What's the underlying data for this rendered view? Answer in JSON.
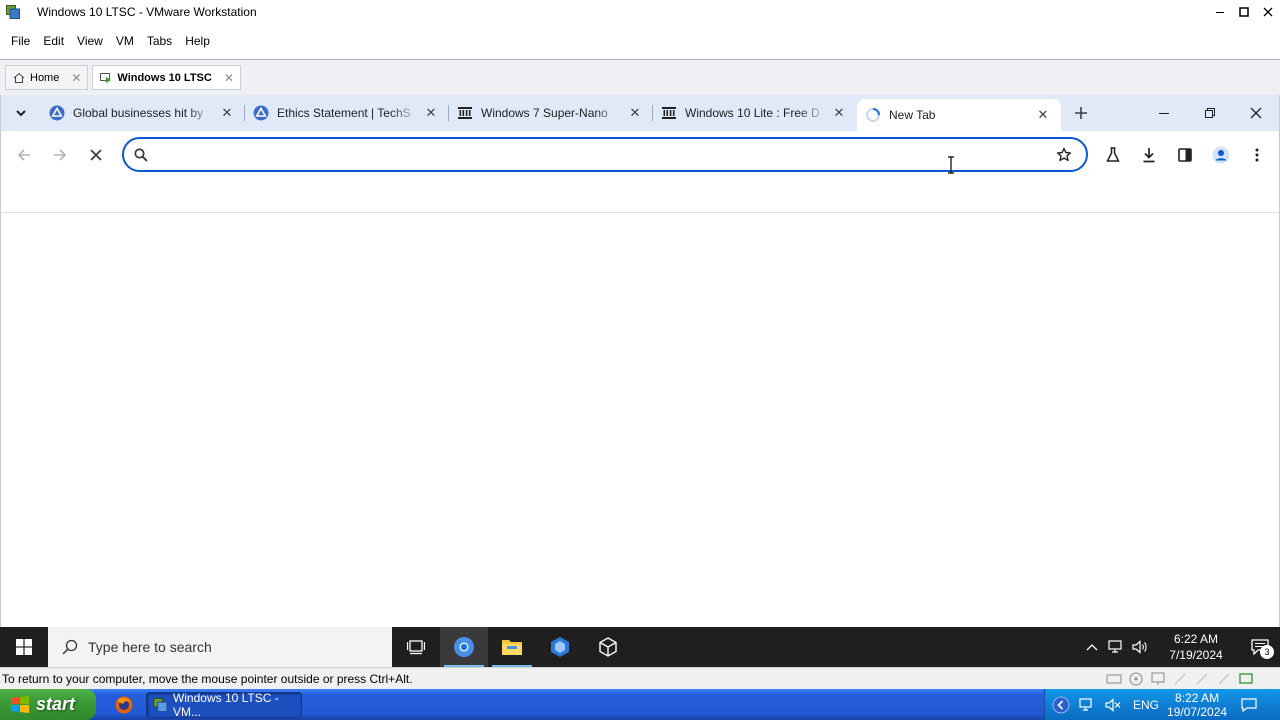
{
  "vmware": {
    "window_title": "Windows 10 LTSC - VMware Workstation",
    "menu": [
      "File",
      "Edit",
      "View",
      "VM",
      "Tabs",
      "Help"
    ],
    "tabs": [
      {
        "label": "Home",
        "active": false
      },
      {
        "label": "Windows 10 LTSC",
        "active": true
      }
    ],
    "status_text": "To return to your computer, move the mouse pointer outside or press Ctrl+Alt."
  },
  "chrome": {
    "tabs": [
      {
        "title": "Global businesses hit by",
        "icon": "triangle-logo-icon"
      },
      {
        "title": "Ethics Statement | TechS",
        "icon": "triangle-logo-icon"
      },
      {
        "title": "Windows 7 Super-Nano",
        "icon": "archive-icon"
      },
      {
        "title": "Windows 10 Lite : Free D",
        "icon": "archive-icon"
      },
      {
        "title": "New Tab",
        "icon": "loading-icon"
      }
    ],
    "omnibox": {
      "value": "",
      "placeholder": ""
    },
    "accent": "#0b57d0",
    "tabbar_bg": "#dfe9f8"
  },
  "win10_taskbar": {
    "search_placeholder": "Type here to search",
    "time": "6:22 AM",
    "date": "7/19/2024",
    "notification_count": "3"
  },
  "xp_taskbar": {
    "start_label": "start",
    "task_label": "Windows 10 LTSC - VM...",
    "language": "ENG",
    "time": "8:22 AM",
    "date": "19/07/2024"
  }
}
